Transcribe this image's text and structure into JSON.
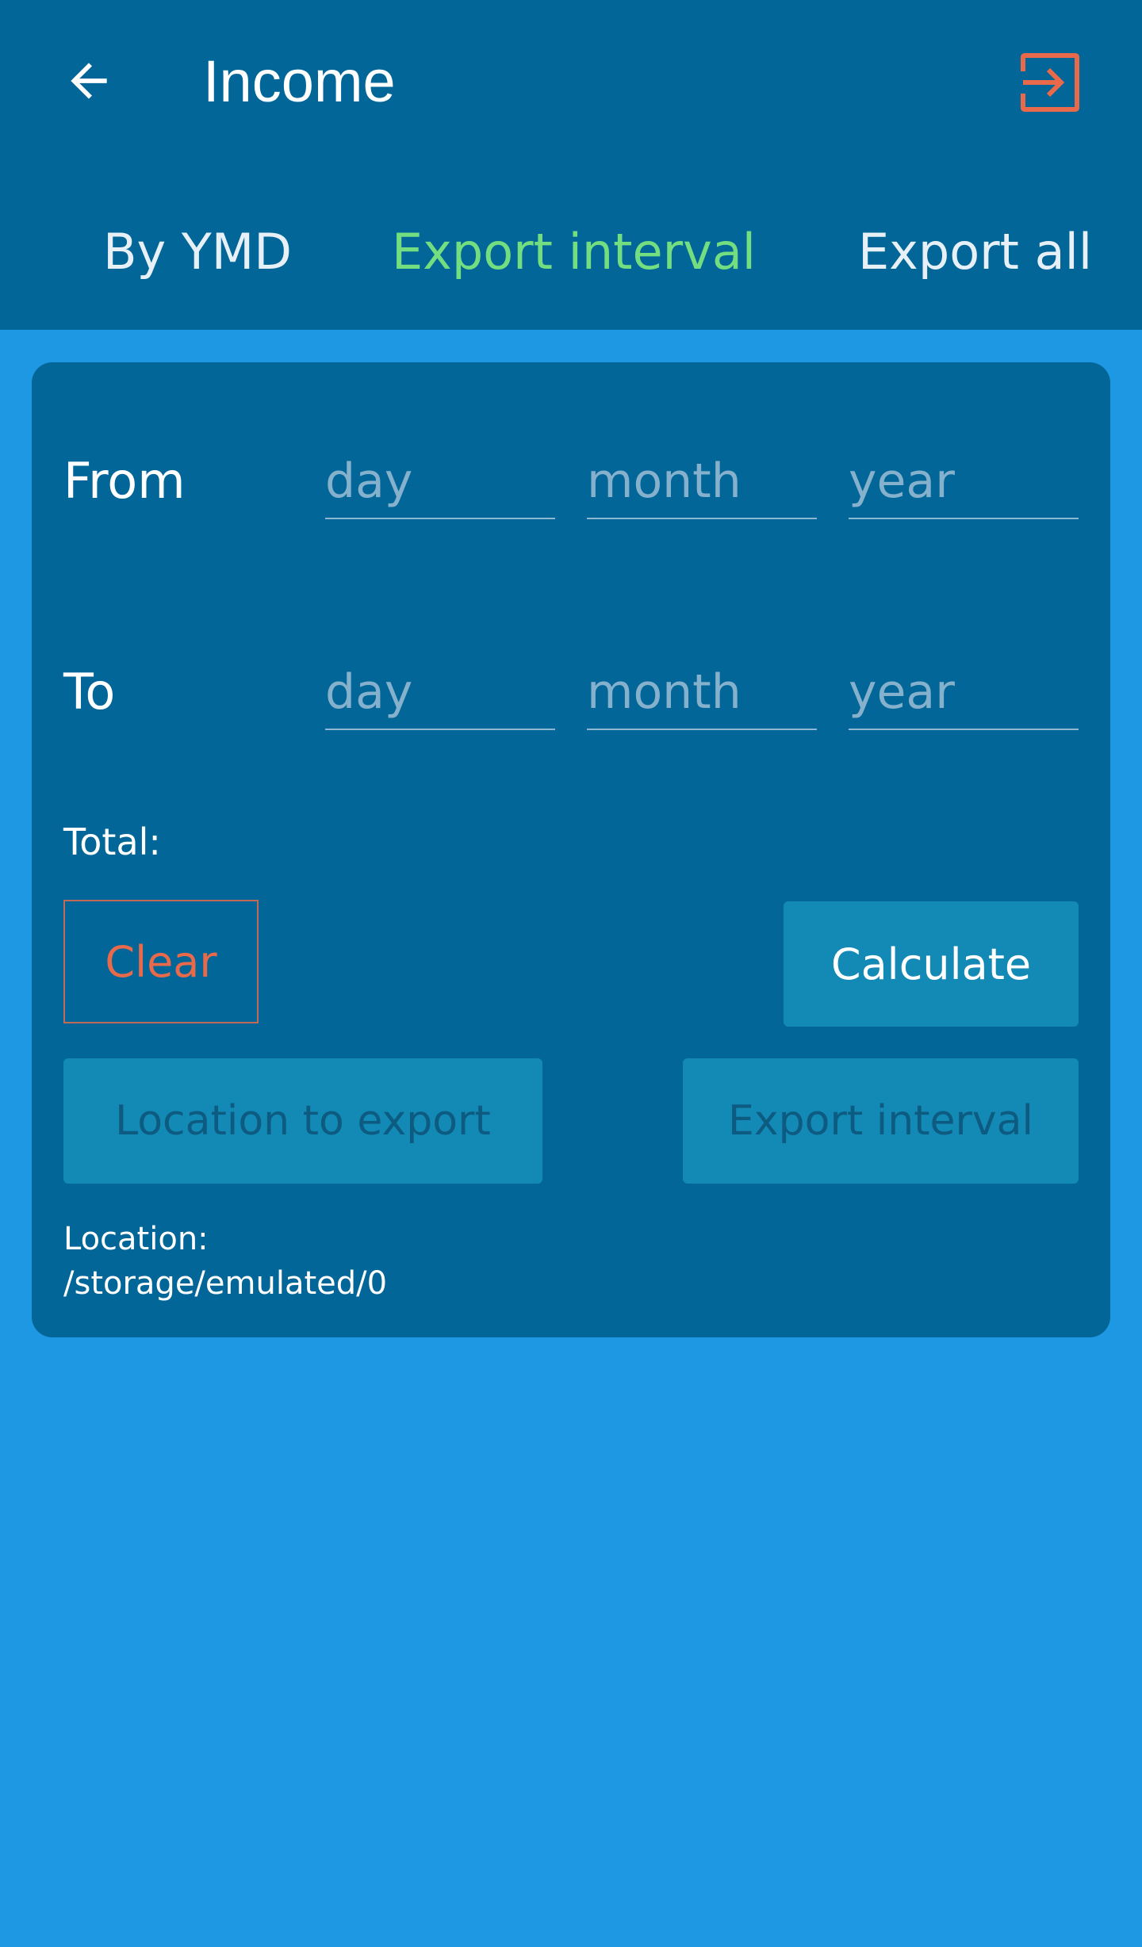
{
  "header": {
    "title": "Income",
    "back_icon": "arrow-left-icon",
    "action_icon": "login-arrow-icon",
    "accent_color": "#e86a4a"
  },
  "tabs": [
    {
      "label": "By YMD",
      "active": false
    },
    {
      "label": "Export interval",
      "active": true
    },
    {
      "label": "Export all",
      "active": false
    }
  ],
  "form": {
    "from_label": "From",
    "to_label": "To",
    "from": {
      "day": {
        "value": "",
        "placeholder": "day"
      },
      "month": {
        "value": "",
        "placeholder": "month"
      },
      "year": {
        "value": "",
        "placeholder": "year"
      }
    },
    "to": {
      "day": {
        "value": "",
        "placeholder": "day"
      },
      "month": {
        "value": "",
        "placeholder": "month"
      },
      "year": {
        "value": "",
        "placeholder": "year"
      }
    },
    "total_label": "Total:"
  },
  "buttons": {
    "clear": "Clear",
    "calculate": "Calculate",
    "location_to_export": "Location to export",
    "export_interval": "Export interval"
  },
  "location": {
    "label": "Location:",
    "path": "/storage/emulated/0"
  },
  "colors": {
    "background": "#1e98e2",
    "appbar": "#026698",
    "card": "#026698",
    "active_tab": "#72de80",
    "button": "#1389b6"
  }
}
